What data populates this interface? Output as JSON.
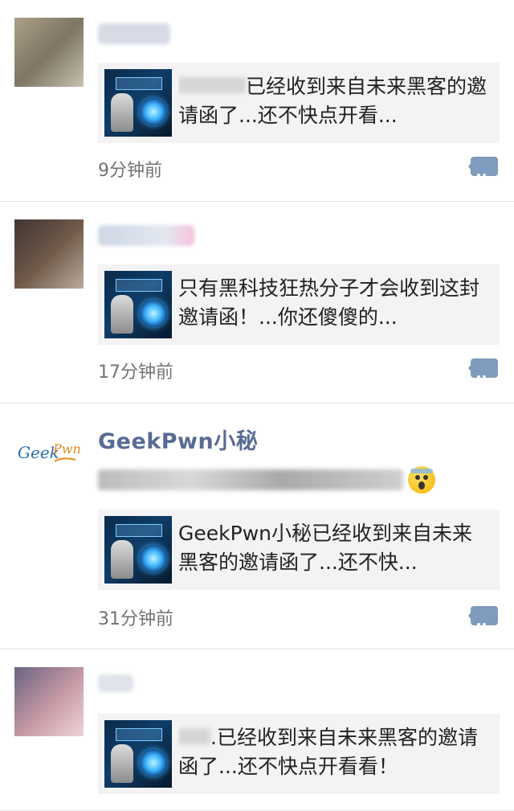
{
  "posts": [
    {
      "name": "",
      "avatar_colors": [
        "#b3a88e",
        "#7d7464",
        "#d3cdb9"
      ],
      "name_blur_color": "#d6dbe6",
      "card": {
        "thumb_icon": "invitation-thumbnail",
        "blurred_prefix": "",
        "text": "已经收到来自未来黑客的邀请函了...还不快点开看..."
      },
      "time": "9分钟前"
    },
    {
      "name": "",
      "avatar_colors": [
        "#3b3030",
        "#6e5848",
        "#c7b7a6"
      ],
      "name_blur_color": "#cfd7e6",
      "card": {
        "thumb_icon": "invitation-thumbnail",
        "blurred_prefix": "",
        "text": "只有黑科技狂热分子才会收到这封邀请函！...你还傻傻的..."
      },
      "time": "17分钟前"
    },
    {
      "name": "GeekPwn小秘",
      "avatar_icon": "geekpwn-logo-icon",
      "status_blur_color": "#bcbcbc",
      "status_emoji_icon": "scared-face-emoji-icon",
      "card": {
        "thumb_icon": "invitation-thumbnail",
        "blurred_prefix": "",
        "text": "GeekPwn小秘已经收到来自未来黑客的邀请函了...还不快..."
      },
      "time": "31分钟前"
    },
    {
      "name": "",
      "avatar_colors": [
        "#5e5a7d",
        "#c99ca6",
        "#f3dede"
      ],
      "name_blur_color": "#dfe3ea",
      "card": {
        "thumb_icon": "invitation-thumbnail",
        "blurred_prefix": "",
        "text": ".已经收到来自未来黑客的邀请函了...还不快点开看看！"
      },
      "time": ""
    }
  ],
  "colors": {
    "name": "#576b95",
    "comment_icon": "#7f9bbd",
    "card_bg": "#f3f3f5",
    "time": "#737373"
  }
}
